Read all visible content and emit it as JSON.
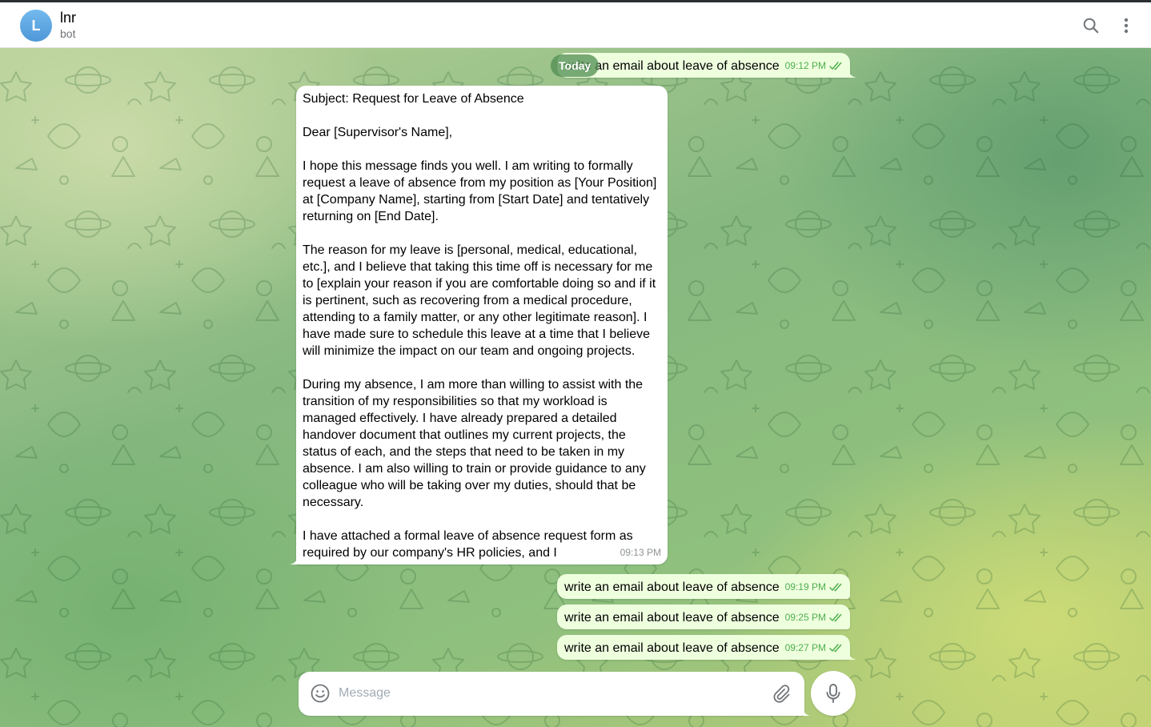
{
  "header": {
    "avatar_letter": "L",
    "chat_name": "lnr",
    "chat_status": "bot",
    "search_icon": "search-icon",
    "more_icon": "more-vertical-icon"
  },
  "date_divider": "Today",
  "messages": [
    {
      "direction": "out",
      "text": "write an email about leave of absence",
      "time": "09:12 PM",
      "status": "read"
    },
    {
      "direction": "in",
      "text": "Subject: Request for Leave of Absence\n\nDear [Supervisor's Name],\n\nI hope this message finds you well. I am writing to formally request a leave of absence from my position as [Your Position] at [Company Name], starting from [Start Date] and tentatively returning on [End Date].\n\nThe reason for my leave is [personal, medical, educational, etc.], and I believe that taking this time off is necessary for me to [explain your reason if you are comfortable doing so and if it is pertinent, such as recovering from a medical procedure, attending to a family matter, or any other legitimate reason]. I have made sure to schedule this leave at a time that I believe will minimize the impact on our team and ongoing projects.\n\nDuring my absence, I am more than willing to assist with the transition of my responsibilities so that my workload is managed effectively. I have already prepared a detailed handover document that outlines my current projects, the status of each, and the steps that need to be taken in my absence. I am also willing to train or provide guidance to any colleague who will be taking over my duties, should that be necessary.\n\nI have attached a formal leave of absence request form as required by our company's HR policies, and I",
      "time": "09:13 PM"
    },
    {
      "direction": "out",
      "text": "write an email about leave of absence",
      "time": "09:19 PM",
      "status": "read"
    },
    {
      "direction": "out",
      "text": "write an email about leave of absence",
      "time": "09:25 PM",
      "status": "read"
    },
    {
      "direction": "out",
      "text": "write an email about leave of absence",
      "time": "09:27 PM",
      "status": "read"
    }
  ],
  "composer": {
    "placeholder": "Message",
    "value": "",
    "emoji_icon": "smile-icon",
    "attach_icon": "paperclip-icon",
    "mic_icon": "microphone-icon"
  },
  "colors": {
    "outgoing_bubble": "#eeffde",
    "incoming_bubble": "#ffffff",
    "read_check": "#4fae4e",
    "avatar": "#5aa6e3"
  }
}
